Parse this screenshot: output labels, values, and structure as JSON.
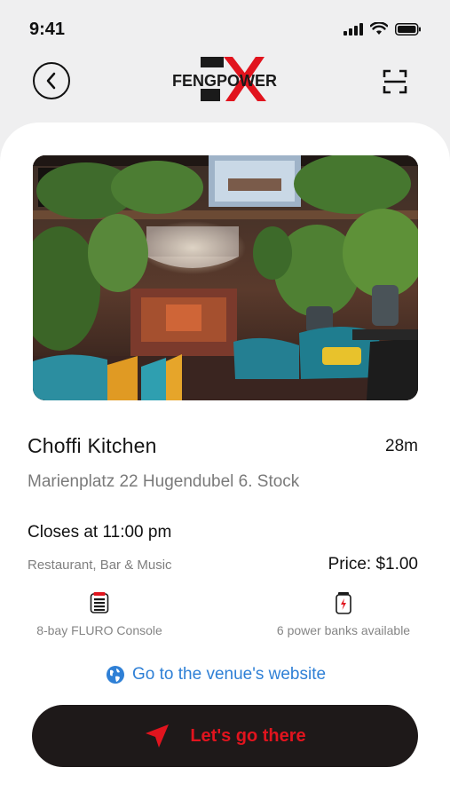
{
  "status_bar": {
    "time": "9:41"
  },
  "header": {
    "logo_text_left": "FENG",
    "logo_text_right": "POWER",
    "logo_mark": "X"
  },
  "venue": {
    "name": "Choffi Kitchen",
    "distance": "28m",
    "address": "Marienplatz 22 Hugendubel 6. Stock",
    "closing": "Closes at 11:00 pm",
    "category": "Restaurant, Bar & Music",
    "price": "Price: $1.00"
  },
  "features": [
    {
      "icon": "console-icon",
      "label": "8-bay FLURO Console"
    },
    {
      "icon": "battery-icon",
      "label": "6 power banks available"
    }
  ],
  "website_link": "Go to the venue's website",
  "cta_label": "Let's go there",
  "colors": {
    "accent_red": "#e1141e",
    "link_blue": "#2f80d6",
    "button_dark": "#1e1919"
  }
}
